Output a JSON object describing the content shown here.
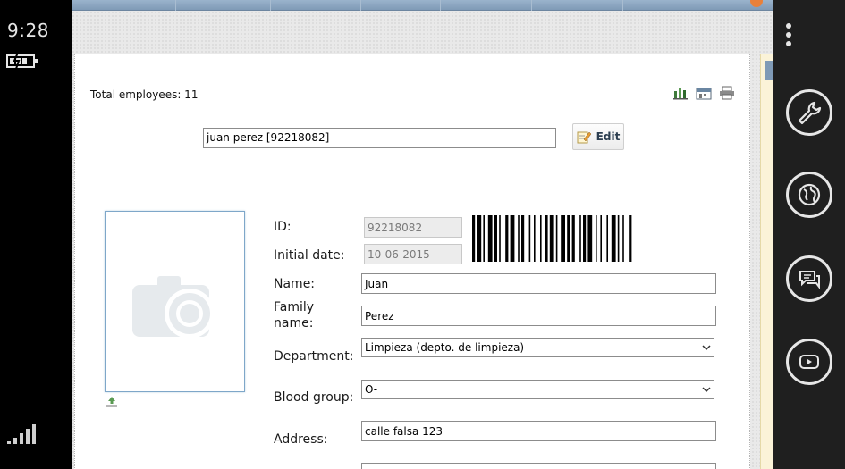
{
  "status_bar": {
    "time": "9:28",
    "battery_icon": "battery-charging-icon",
    "signal_icon": "signal-bars-icon"
  },
  "page": {
    "total_employees": "Total employees: 11",
    "toolbar_icons": [
      "chart-icon",
      "calendar-icon",
      "print-icon"
    ],
    "employee_selector": "juan perez [92218082]",
    "edit_label": "Edit"
  },
  "form": {
    "id_label": "ID:",
    "id_value": "92218082",
    "initial_date_label": "Initial date:",
    "initial_date_value": "10-06-2015",
    "name_label": "Name:",
    "name_value": "Juan",
    "family_name_label_line1": "Family",
    "family_name_label_line2": "name:",
    "family_name_value": "Perez",
    "department_label": "Department:",
    "department_value": "Limpieza (depto. de limpieza)",
    "blood_group_label": "Blood group:",
    "blood_group_value": "O-",
    "address_label": "Address:",
    "address_value": "calle falsa 123"
  },
  "app_bar": {
    "buttons": [
      "wrench-icon",
      "globe-icon",
      "chat-icon",
      "video-icon"
    ]
  },
  "colors": {
    "accent_blue": "#7f9ab6",
    "photo_border": "#7ea7c9",
    "sidebar_bg": "#fbf3d8"
  }
}
